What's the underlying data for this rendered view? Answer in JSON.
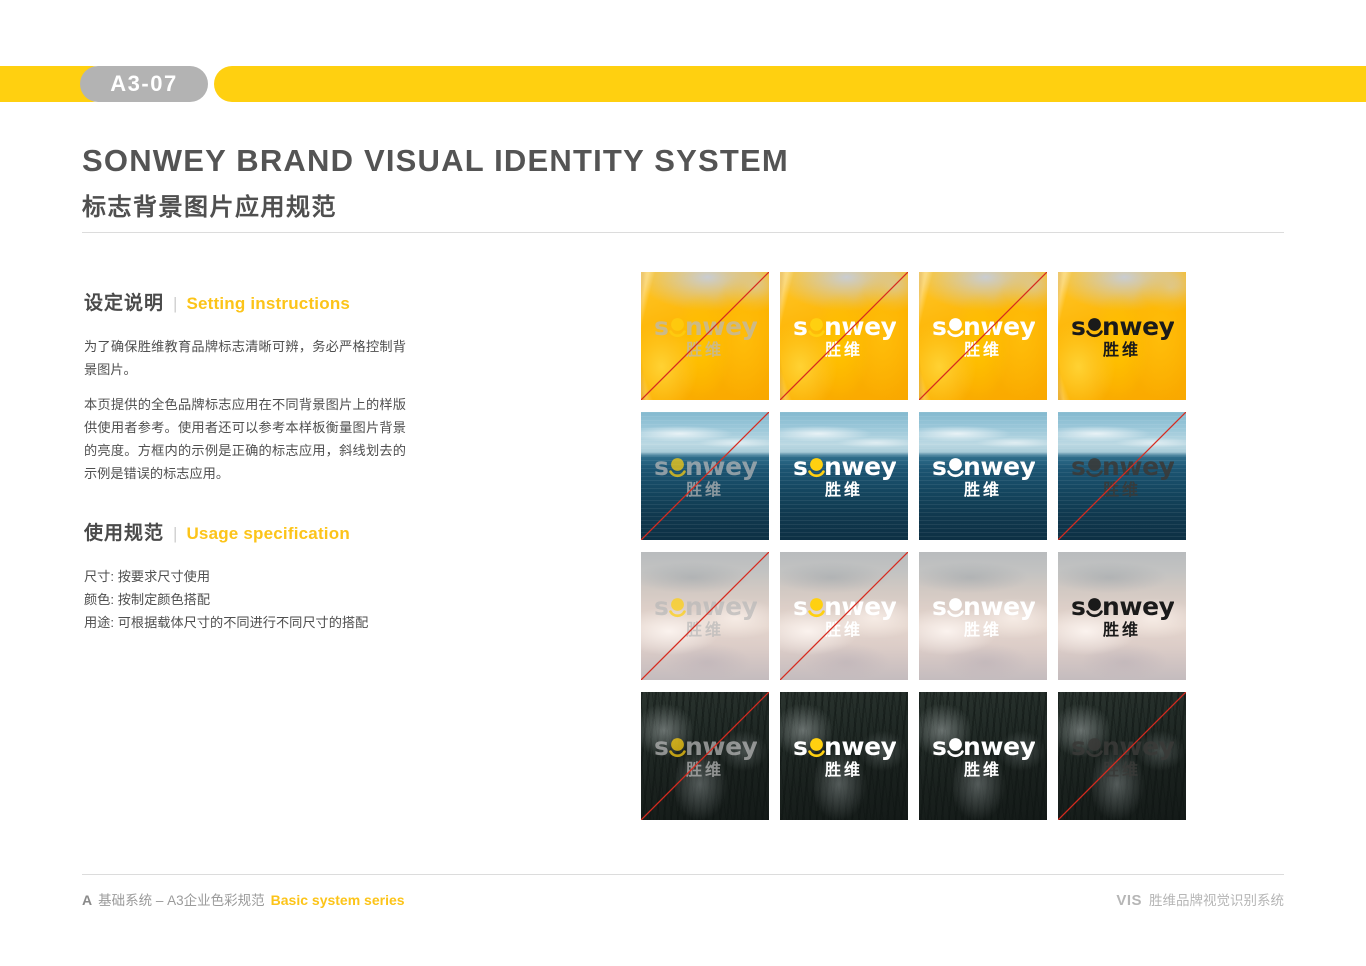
{
  "header": {
    "page_code": "A3-07",
    "title_en": "SONWEY BRAND VISUAL IDENTITY SYSTEM",
    "title_cn": "标志背景图片应用规范",
    "bar_color": "#ffd010",
    "badge_color": "#b3b3b3"
  },
  "sections": {
    "setting": {
      "cn": "设定说明",
      "divider": "|",
      "en": "Setting instructions",
      "paragraphs": [
        "为了确保胜维教育品牌标志清晰可辨，务必严格控制背景图片。",
        "本页提供的全色品牌标志应用在不同背景图片上的样版供使用者参考。使用者还可以参考本样板衡量图片背景的亮度。方框内的示例是正确的标志应用，斜线划去的示例是错误的标志应用。"
      ]
    },
    "usage": {
      "cn": "使用规范",
      "divider": "|",
      "en": "Usage specification",
      "lines": [
        "尺寸: 按要求尺寸使用",
        "颜色: 按制定颜色搭配",
        "用途: 可根据载体尺寸的不同进行不同尺寸的搭配"
      ]
    }
  },
  "logo": {
    "wordmark": "sonwey",
    "chinese": "胜维"
  },
  "grid": {
    "columns": 4,
    "rows": 4,
    "tiles": [
      {
        "row": 1,
        "col": 1,
        "background": "flower",
        "background_label": "黄色花朵",
        "logo_variant": "lg-gray-y",
        "opacity_class": "op70",
        "valid": false,
        "strike": true
      },
      {
        "row": 1,
        "col": 2,
        "background": "flower",
        "background_label": "黄色花朵",
        "logo_variant": "lg-white-y",
        "opacity_class": "",
        "valid": false,
        "strike": true
      },
      {
        "row": 1,
        "col": 3,
        "background": "flower",
        "background_label": "黄色花朵",
        "logo_variant": "lg-white",
        "opacity_class": "",
        "valid": false,
        "strike": true
      },
      {
        "row": 1,
        "col": 4,
        "background": "flower",
        "background_label": "黄色花朵",
        "logo_variant": "lg-dark",
        "opacity_class": "",
        "valid": true,
        "strike": false
      },
      {
        "row": 2,
        "col": 1,
        "background": "sea",
        "background_label": "海洋",
        "logo_variant": "lg-gray-y",
        "opacity_class": "op70",
        "valid": false,
        "strike": true
      },
      {
        "row": 2,
        "col": 2,
        "background": "sea",
        "background_label": "海洋",
        "logo_variant": "lg-white-y",
        "opacity_class": "",
        "valid": true,
        "strike": false
      },
      {
        "row": 2,
        "col": 3,
        "background": "sea",
        "background_label": "海洋",
        "logo_variant": "lg-white",
        "opacity_class": "",
        "valid": true,
        "strike": false
      },
      {
        "row": 2,
        "col": 4,
        "background": "sea",
        "background_label": "海洋",
        "logo_variant": "lg-lowc",
        "opacity_class": "op85",
        "valid": false,
        "strike": true
      },
      {
        "row": 3,
        "col": 1,
        "background": "cloud",
        "background_label": "云雾",
        "logo_variant": "lg-gray-y",
        "opacity_class": "op70",
        "valid": false,
        "strike": true
      },
      {
        "row": 3,
        "col": 2,
        "background": "cloud",
        "background_label": "云雾",
        "logo_variant": "lg-white-y",
        "opacity_class": "",
        "valid": false,
        "strike": true
      },
      {
        "row": 3,
        "col": 3,
        "background": "cloud",
        "background_label": "云雾",
        "logo_variant": "lg-white",
        "opacity_class": "",
        "valid": true,
        "strike": false
      },
      {
        "row": 3,
        "col": 4,
        "background": "cloud",
        "background_label": "云雾",
        "logo_variant": "lg-dark",
        "opacity_class": "",
        "valid": true,
        "strike": false
      },
      {
        "row": 4,
        "col": 1,
        "background": "forest",
        "background_label": "森林",
        "logo_variant": "lg-gray-y",
        "opacity_class": "op70",
        "valid": false,
        "strike": true
      },
      {
        "row": 4,
        "col": 2,
        "background": "forest",
        "background_label": "森林",
        "logo_variant": "lg-white-y",
        "opacity_class": "",
        "valid": true,
        "strike": false
      },
      {
        "row": 4,
        "col": 3,
        "background": "forest",
        "background_label": "森林",
        "logo_variant": "lg-white",
        "opacity_class": "",
        "valid": true,
        "strike": false
      },
      {
        "row": 4,
        "col": 4,
        "background": "forest",
        "background_label": "森林",
        "logo_variant": "lg-lowc",
        "opacity_class": "op85",
        "valid": false,
        "strike": true
      }
    ]
  },
  "footer": {
    "left_code": "A",
    "left_cn": "基础系统 – A3企业色彩规范",
    "left_en": "Basic system series",
    "right_code": "VIS",
    "right_cn": "胜维品牌视觉识别系统"
  },
  "colors": {
    "brand_yellow": "#ffd010",
    "accent_yellow": "#fcc419",
    "text_dark": "#4f4f4f",
    "strike_red": "#d62b1f",
    "rule_gray": "#dcdcdc"
  }
}
